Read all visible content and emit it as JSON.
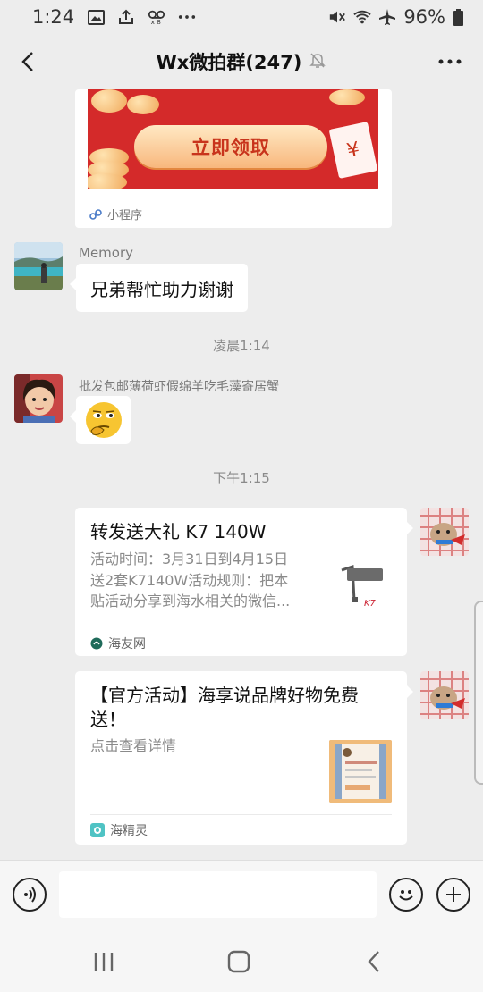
{
  "status_bar": {
    "time": "1:24",
    "battery": "96%",
    "left_icons": [
      "image-icon",
      "upload-icon",
      "voicemail-icon",
      "more-dots-icon"
    ],
    "right_icons": [
      "mute-icon",
      "wifi-icon",
      "airplane-icon",
      "battery-icon"
    ]
  },
  "header": {
    "title": "Wx微拍群(247)",
    "muted_icon": "bell-off-icon"
  },
  "messages": {
    "mini_program": {
      "button_label": "立即领取",
      "ticket_symbol": "¥",
      "footer_label": "小程序"
    },
    "msg1": {
      "sender": "Memory",
      "text": "兄弟帮忙助力谢谢"
    },
    "time1": "凌晨1:14",
    "msg2": {
      "sender": "批发包邮薄荷虾假绵羊吃毛藻寄居蟹"
    },
    "time2": "下午1:15",
    "card1": {
      "title": "转发送大礼 K7 140W",
      "desc_lines": [
        "活动时间：3月31日到4月15日",
        "送2套K7140W活动规则：把本",
        "贴活动分享到海水相关的微信..."
      ],
      "source": "海友网"
    },
    "card2": {
      "title_lines": [
        "【官方活动】海享说品牌好物免费",
        "送！"
      ],
      "desc": "点击查看详情",
      "source": "海精灵"
    }
  },
  "colors": {
    "background": "#ededed",
    "red_packet": "#d42a2a",
    "button_text": "#c8341c"
  }
}
